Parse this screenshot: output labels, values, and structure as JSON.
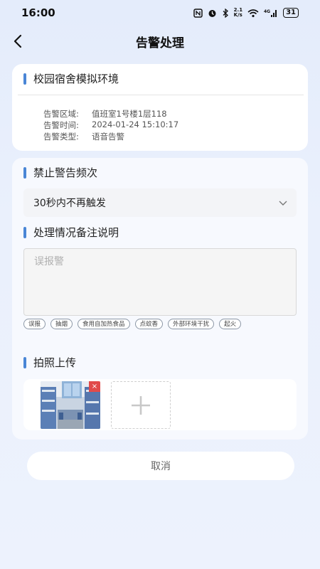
{
  "status_bar": {
    "time": "16:00",
    "icons": [
      "nfc-icon",
      "alarm-icon",
      "bluetooth-icon",
      "network-speed-icon",
      "wifi-icon",
      "signal-icon",
      "battery-icon"
    ],
    "net_speed": "2.1\nK/s",
    "battery": "31"
  },
  "nav": {
    "title": "告警处理",
    "back_icon": "chevron-left-icon"
  },
  "alarm_info": {
    "title": "校园宿舍模拟环境",
    "rows": [
      {
        "label": "告警区域:",
        "value": "值班室1号楼1层118"
      },
      {
        "label": "告警时间:",
        "value": "2024-01-24 15:10:17"
      },
      {
        "label": "告警类型:",
        "value": "语音告警"
      }
    ]
  },
  "frequency": {
    "title": "禁止警告频次",
    "selected": "30秒内不再触发"
  },
  "remark": {
    "title": "处理情况备注说明",
    "placeholder": "误报警",
    "tags": [
      "误报",
      "抽烟",
      "食用自加热食品",
      "点蚊香",
      "外部环境干扰",
      "起火"
    ]
  },
  "photo": {
    "title": "拍照上传",
    "delete_label": "×",
    "add_label": "+"
  },
  "cancel_label": "取消",
  "colors": {
    "accent": "#4a86d6",
    "delete": "#e14b4b",
    "background": "#e8eefc"
  }
}
